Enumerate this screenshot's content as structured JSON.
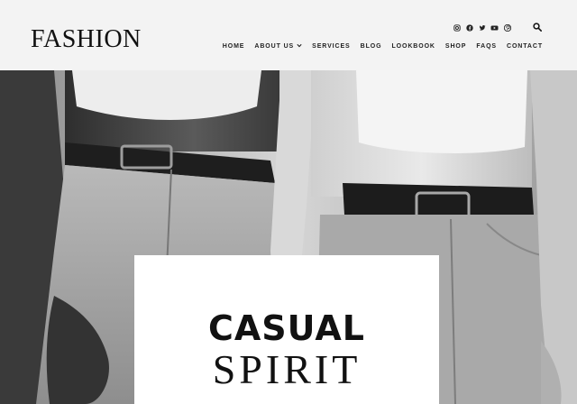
{
  "header": {
    "logo": "FASHION",
    "social_icons": [
      "instagram-icon",
      "facebook-icon",
      "twitter-icon",
      "youtube-icon",
      "pinterest-icon"
    ],
    "search_icon": "search-icon",
    "nav": [
      {
        "label": "HOME"
      },
      {
        "label": "ABOUT US",
        "has_dropdown": true
      },
      {
        "label": "SERVICES"
      },
      {
        "label": "BLOG"
      },
      {
        "label": "LOOKBOOK"
      },
      {
        "label": "SHOP"
      },
      {
        "label": "FAQS"
      },
      {
        "label": "CONTACT"
      }
    ]
  },
  "hero": {
    "title_line1": "CASUAL",
    "title_line2": "SPIRIT"
  },
  "colors": {
    "header_bg": "#f3f3f3",
    "text": "#111111",
    "card_bg": "#ffffff"
  }
}
